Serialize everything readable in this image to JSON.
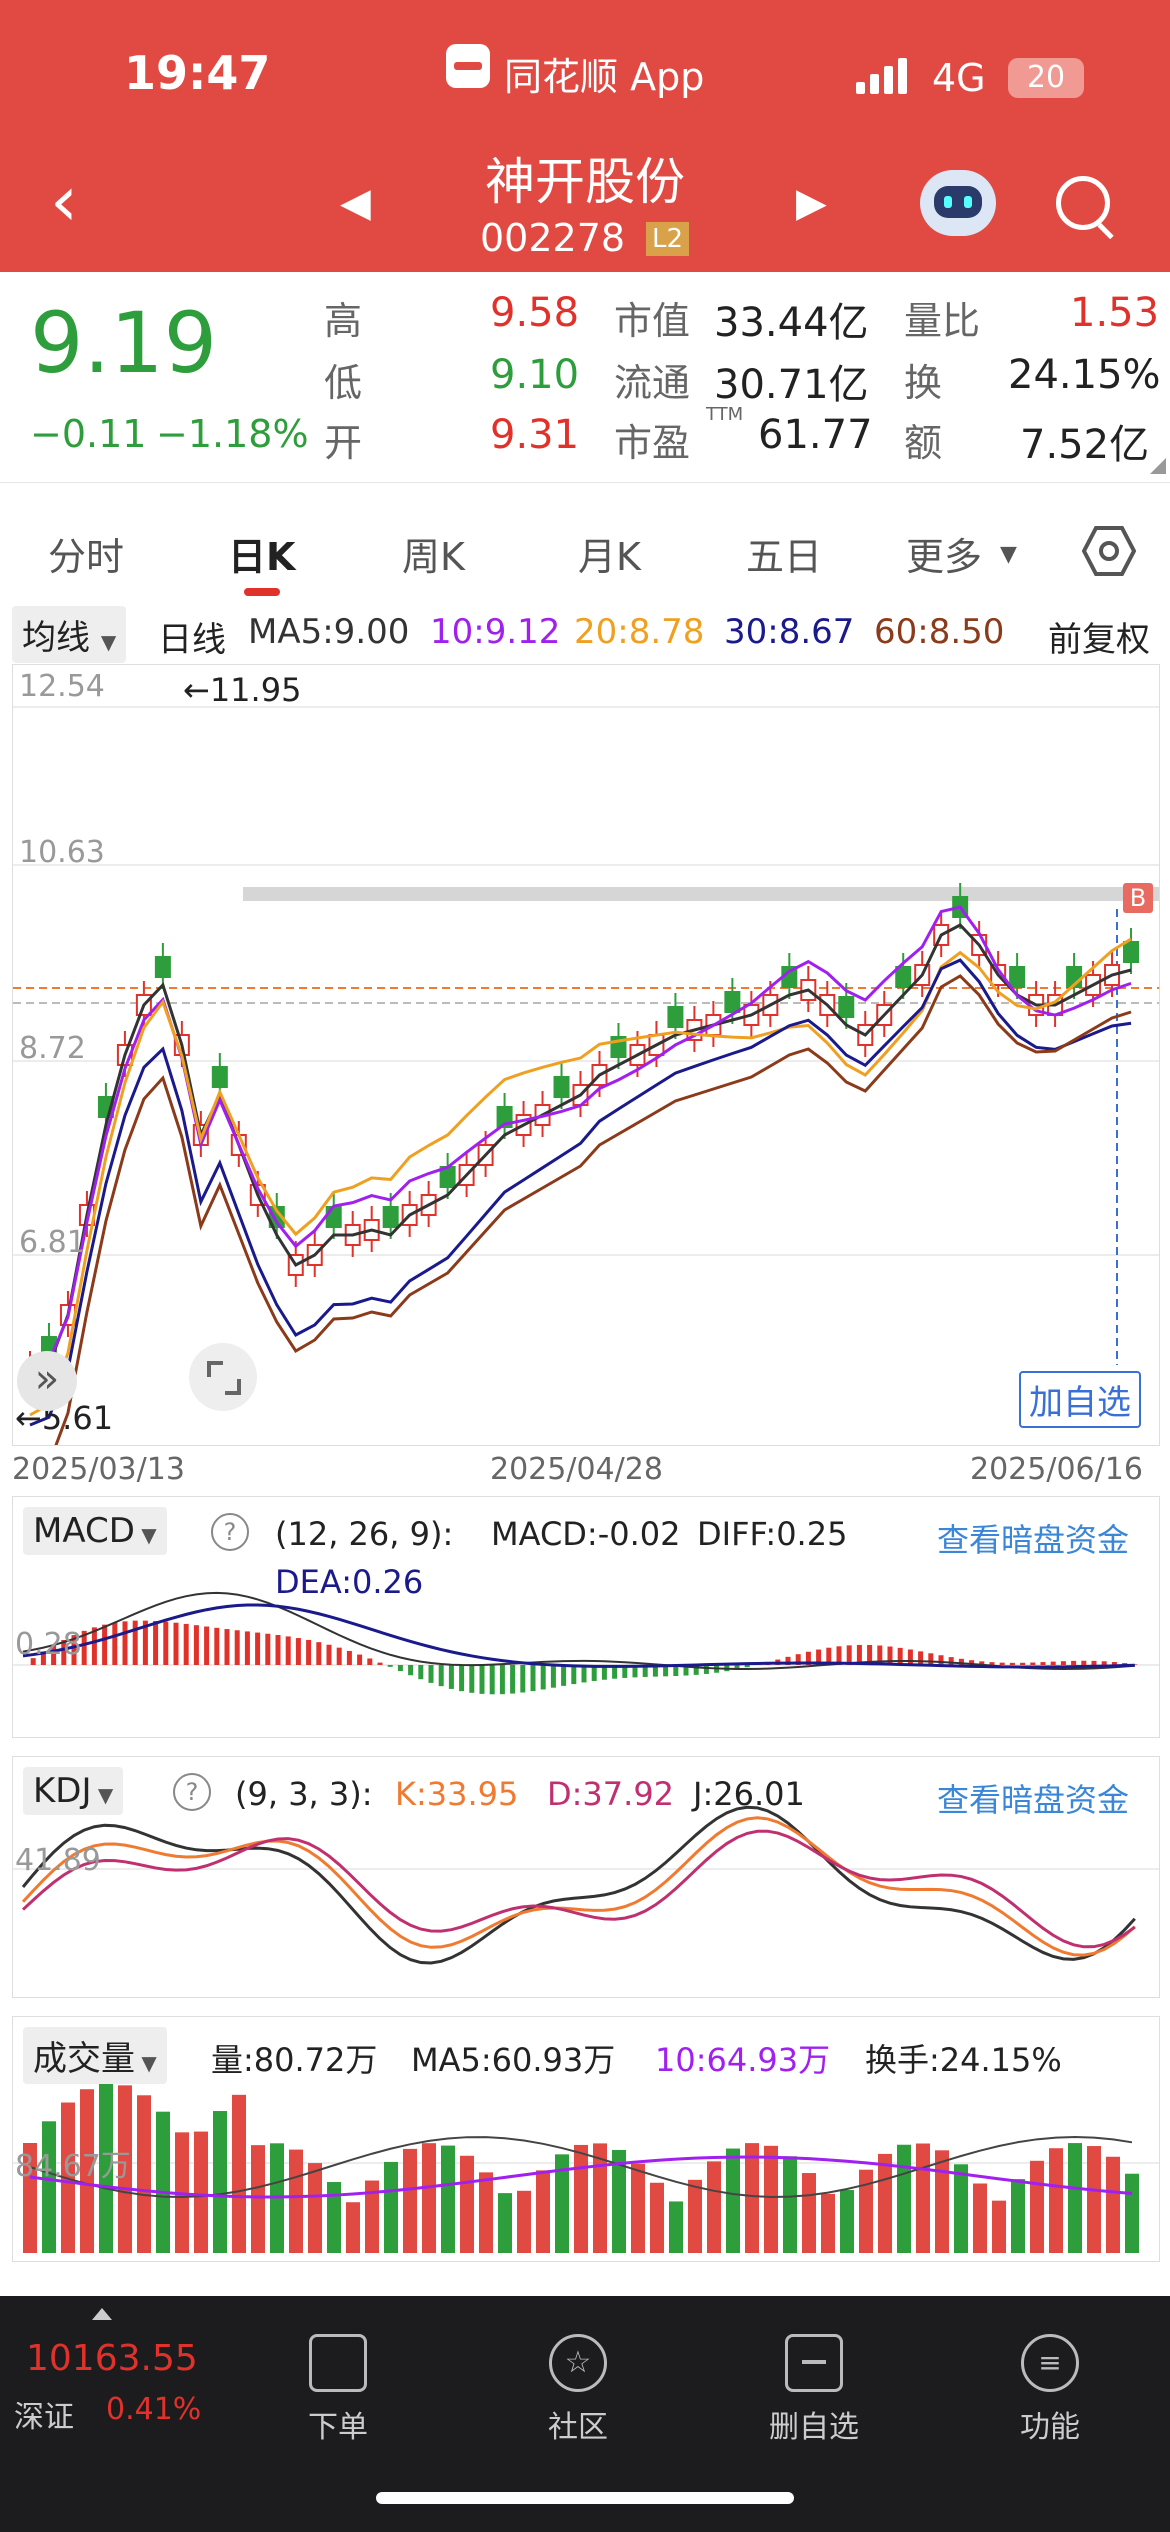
{
  "status_bar": {
    "time": "19:47",
    "app_name": "同花顺 App",
    "network": "4G",
    "battery": "20"
  },
  "header": {
    "stock_name": "神开股份",
    "stock_code": "002278",
    "level_badge": "L2"
  },
  "quote": {
    "price": "9.19",
    "change": "−0.11",
    "change_pct": "−1.18%",
    "high_label": "高",
    "high": "9.58",
    "low_label": "低",
    "low": "9.10",
    "open_label": "开",
    "open": "9.31",
    "mcap_label": "市值",
    "mcap": "33.44亿",
    "float_label": "流通",
    "float": "30.71亿",
    "pe_label": "市盈",
    "pe_sup": "TTM",
    "pe": "61.77",
    "vol_ratio_label": "量比",
    "vol_ratio": "1.53",
    "turnover_label": "换",
    "turnover": "24.15%",
    "amount_label": "额",
    "amount": "7.52亿"
  },
  "tabs": [
    {
      "label": "分时"
    },
    {
      "label": "日K"
    },
    {
      "label": "周K"
    },
    {
      "label": "月K"
    },
    {
      "label": "五日"
    },
    {
      "label": "更多"
    }
  ],
  "kline": {
    "indicator_select": "均线",
    "period": "日线",
    "ma5": "MA5:9.00",
    "ma10": "10:9.12",
    "ma20": "20:8.78",
    "ma30": "30:8.67",
    "ma60": "60:8.50",
    "adjust": "前复权",
    "y_ticks": [
      "12.54",
      "10.63",
      "8.72",
      "6.81"
    ],
    "high_mark": "←11.95",
    "low_mark": "←5.61",
    "x_dates": [
      "2025/03/13",
      "2025/04/28",
      "2025/06/16"
    ],
    "buy_marker": "B",
    "add_watch": "加自选"
  },
  "macd": {
    "select": "MACD",
    "params": "(12, 26, 9):",
    "macd": "MACD:-0.02",
    "diff": "DIFF:0.25",
    "dea": "DEA:0.26",
    "link": "查看暗盘资金",
    "tick": "0.28"
  },
  "kdj": {
    "select": "KDJ",
    "params": "(9, 3, 3):",
    "k": "K:33.95",
    "d": "D:37.92",
    "j": "J:26.01",
    "link": "查看暗盘资金",
    "tick": "41.89"
  },
  "volume": {
    "select": "成交量",
    "vol": "量:80.72万",
    "ma5": "MA5:60.93万",
    "ma10": "10:64.93万",
    "turnover": "换手:24.15%",
    "tick": "84.67万"
  },
  "bottom_nav": {
    "index_value": "10163.55",
    "index_name": "深证",
    "index_pct": "0.41%",
    "items": [
      {
        "label": "下单"
      },
      {
        "label": "社区"
      },
      {
        "label": "删自选"
      },
      {
        "label": "功能"
      }
    ]
  },
  "colors": {
    "brand_red": "#e04a42",
    "up": "#e0322a",
    "down": "#2e9e3c",
    "ma5": "#333333",
    "ma10": "#a020f0",
    "ma20": "#f0a020",
    "ma30": "#1a1a8c",
    "ma60": "#8b3a1a"
  }
}
